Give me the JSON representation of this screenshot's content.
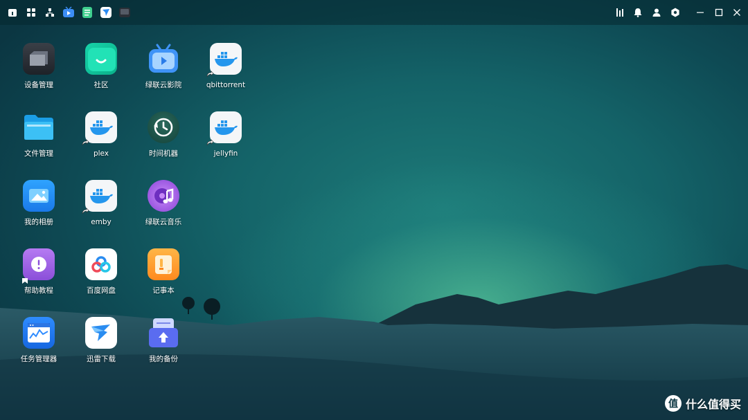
{
  "topbar": {
    "left_icons": [
      "home-icon",
      "apps-grid-icon",
      "network-icon",
      "video-app-icon",
      "note-app-icon",
      "thunder-app-icon",
      "device-app-icon"
    ],
    "right_icons": [
      "equalizer-icon",
      "bell-icon",
      "user-icon",
      "settings-hex-icon",
      "minimize-icon",
      "maximize-icon",
      "close-icon"
    ]
  },
  "desktop": {
    "apps": [
      {
        "label": "设备管理",
        "icon": "device-management-icon"
      },
      {
        "label": "社区",
        "icon": "community-icon"
      },
      {
        "label": "绿联云影院",
        "icon": "cinema-icon"
      },
      {
        "label": "qbittorrent",
        "icon": "docker-icon"
      },
      {
        "label": "文件管理",
        "icon": "folder-icon"
      },
      {
        "label": "plex",
        "icon": "docker-icon"
      },
      {
        "label": "时间机器",
        "icon": "time-machine-icon"
      },
      {
        "label": "jellyfin",
        "icon": "docker-icon"
      },
      {
        "label": "我的相册",
        "icon": "photos-icon"
      },
      {
        "label": "emby",
        "icon": "docker-icon"
      },
      {
        "label": "绿联云音乐",
        "icon": "music-icon"
      },
      {
        "label": "帮助教程",
        "icon": "help-icon"
      },
      {
        "label": "百度网盘",
        "icon": "baidu-netdisk-icon"
      },
      {
        "label": "记事本",
        "icon": "notepad-icon"
      },
      {
        "label": "任务管理器",
        "icon": "task-manager-icon"
      },
      {
        "label": "迅雷下载",
        "icon": "thunder-download-icon"
      },
      {
        "label": "我的备份",
        "icon": "backup-icon"
      }
    ]
  },
  "watermark": {
    "text": "什么值得买",
    "logo": "值"
  },
  "colors": {
    "accent": "#2a8cf0",
    "wallpaper_glow": "#6ee6aa"
  }
}
